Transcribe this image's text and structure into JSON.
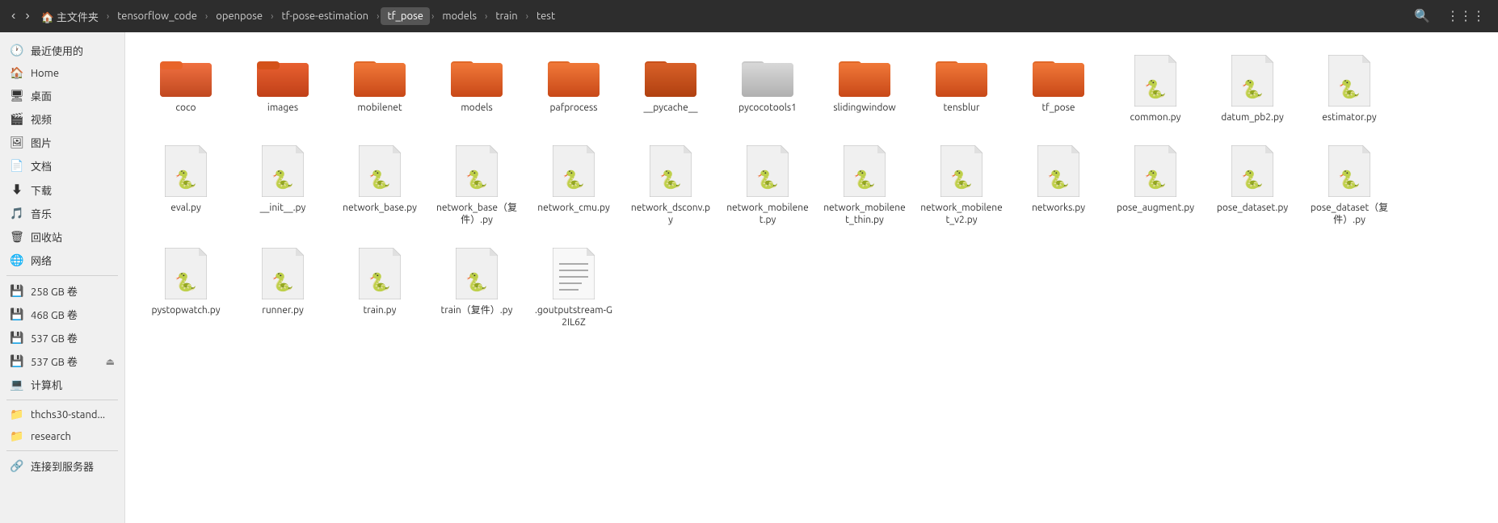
{
  "topbar": {
    "nav_back_label": "‹",
    "nav_forward_label": "›",
    "breadcrumbs": [
      {
        "label": "主文件夹",
        "active": false
      },
      {
        "label": "tensorflow_code",
        "active": false
      },
      {
        "label": "openpose",
        "active": false
      },
      {
        "label": "tf-pose-estimation",
        "active": false
      },
      {
        "label": "tf_pose",
        "active": true
      },
      {
        "label": "models",
        "active": false
      },
      {
        "label": "train",
        "active": false
      },
      {
        "label": "test",
        "active": false
      }
    ],
    "search_label": "🔍",
    "view_label": "⋮⋮⋮"
  },
  "sidebar": {
    "items": [
      {
        "icon": "🕐",
        "label": "最近使用的",
        "type": "item"
      },
      {
        "icon": "🏠",
        "label": "Home",
        "type": "item"
      },
      {
        "icon": "🖥",
        "label": "桌面",
        "type": "item"
      },
      {
        "icon": "🎬",
        "label": "视频",
        "type": "item"
      },
      {
        "icon": "🖼",
        "label": "图片",
        "type": "item"
      },
      {
        "icon": "📄",
        "label": "文档",
        "type": "item"
      },
      {
        "icon": "⬇",
        "label": "下载",
        "type": "item"
      },
      {
        "icon": "🎵",
        "label": "音乐",
        "type": "item"
      },
      {
        "icon": "🗑",
        "label": "回收站",
        "type": "item"
      },
      {
        "icon": "🌐",
        "label": "网络",
        "type": "item"
      },
      {
        "type": "separator"
      },
      {
        "icon": "💾",
        "label": "258 GB 卷",
        "type": "item"
      },
      {
        "icon": "💾",
        "label": "468 GB 卷",
        "type": "item"
      },
      {
        "icon": "💾",
        "label": "537 GB 卷",
        "type": "item"
      },
      {
        "icon": "💾",
        "label": "537 GB 卷",
        "type": "item",
        "eject": true
      },
      {
        "icon": "💻",
        "label": "计算机",
        "type": "item"
      },
      {
        "type": "separator"
      },
      {
        "icon": "📁",
        "label": "thchs30-stand...",
        "type": "item"
      },
      {
        "icon": "📁",
        "label": "research",
        "type": "item"
      },
      {
        "type": "separator"
      },
      {
        "icon": "🔗",
        "label": "连接到服务器",
        "type": "item"
      }
    ]
  },
  "files": {
    "folders": [
      {
        "name": "coco"
      },
      {
        "name": "images"
      },
      {
        "name": "mobilenet"
      },
      {
        "name": "models"
      },
      {
        "name": "pafprocess"
      },
      {
        "name": "__pycache__"
      },
      {
        "name": "pycocotools1"
      },
      {
        "name": "slidingwindow"
      },
      {
        "name": "tensblur"
      },
      {
        "name": "tf_pose"
      }
    ],
    "python_files": [
      {
        "name": "common.py"
      },
      {
        "name": "datum_pb2.py"
      },
      {
        "name": "estimator.py"
      },
      {
        "name": "eval.py"
      },
      {
        "name": "__init__.py"
      },
      {
        "name": "network_base.py"
      },
      {
        "name": "network_base（复件）.py"
      },
      {
        "name": "network_cmu.py"
      },
      {
        "name": "network_dsconv.py"
      },
      {
        "name": "network_mobilenet.py"
      },
      {
        "name": "network_mobilenet_thin.py"
      },
      {
        "name": "network_mobilenet_v2.py"
      },
      {
        "name": "networks.py"
      },
      {
        "name": "pose_augment.py"
      },
      {
        "name": "pose_dataset.py"
      },
      {
        "name": "pose_dataset（复件）.py"
      },
      {
        "name": "pystopwatch.py"
      },
      {
        "name": "runner.py"
      },
      {
        "name": "train.py"
      },
      {
        "name": "train（复件）.py"
      }
    ],
    "text_files": [
      {
        "name": ".goutputstream-G2IL6Z"
      }
    ]
  }
}
